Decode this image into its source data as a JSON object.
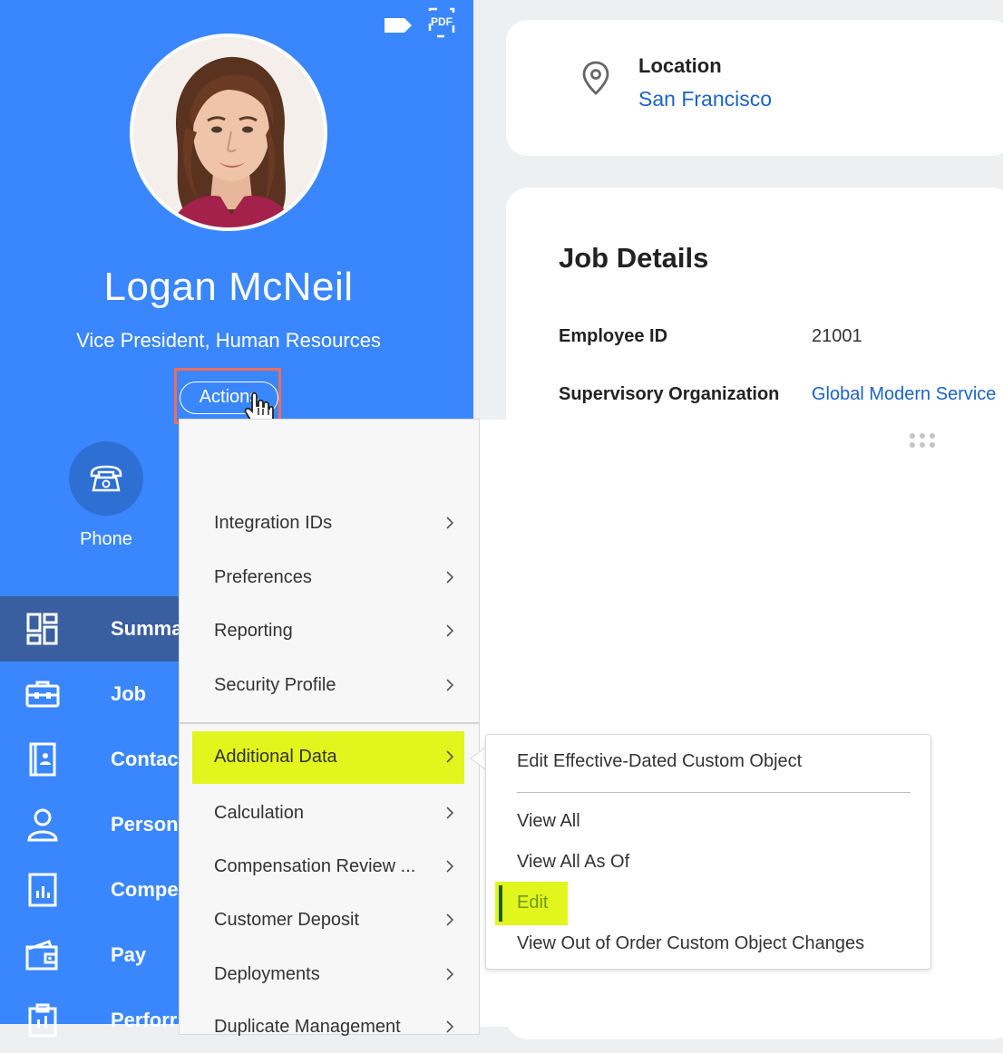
{
  "profile": {
    "name": "Logan McNeil",
    "title": "Vice President, Human Resources",
    "actions_label": "Actions",
    "pdf_label": "PDF",
    "phone_label": "Phone"
  },
  "nav": {
    "items": [
      {
        "label": "Summa",
        "icon": "summary-grid-icon",
        "active": true
      },
      {
        "label": "Job",
        "icon": "briefcase-icon"
      },
      {
        "label": "Contac",
        "icon": "contact-book-icon"
      },
      {
        "label": "Person",
        "icon": "person-icon"
      },
      {
        "label": "Compe",
        "icon": "compensation-chart-icon"
      },
      {
        "label": "Pay",
        "icon": "wallet-icon"
      },
      {
        "label": "Perforr",
        "icon": "clipboard-icon"
      }
    ]
  },
  "location": {
    "title": "Location",
    "value": "San Francisco"
  },
  "job_details": {
    "title": "Job Details",
    "rows": [
      {
        "label": "Employee ID",
        "value": "21001"
      },
      {
        "label": "Supervisory Organization",
        "value": "Global Modern Service"
      }
    ]
  },
  "menu": {
    "items": [
      {
        "label": "Integration IDs"
      },
      {
        "label": "Preferences"
      },
      {
        "label": "Reporting"
      },
      {
        "label": "Security Profile"
      },
      {
        "label": "Additional Data",
        "highlighted": true
      },
      {
        "label": "Calculation"
      },
      {
        "label": "Compensation Review ..."
      },
      {
        "label": "Customer Deposit"
      },
      {
        "label": "Deployments"
      },
      {
        "label": "Duplicate Management"
      }
    ]
  },
  "submenu": {
    "items": [
      {
        "label": "Edit Effective-Dated Custom Object"
      },
      {
        "label": "View All"
      },
      {
        "label": "View All As Of"
      },
      {
        "label": "Edit",
        "highlighted": true
      },
      {
        "label": "View Out of Order Custom Object Changes"
      }
    ]
  },
  "colors": {
    "panel_blue": "#3a87fd",
    "active_nav": "#3a5fa0",
    "link_blue": "#1a63c6",
    "highlight_yellow": "#e2f51c",
    "annotation_red": "#f26b5a",
    "edit_text_green": "#6b9b1a"
  }
}
